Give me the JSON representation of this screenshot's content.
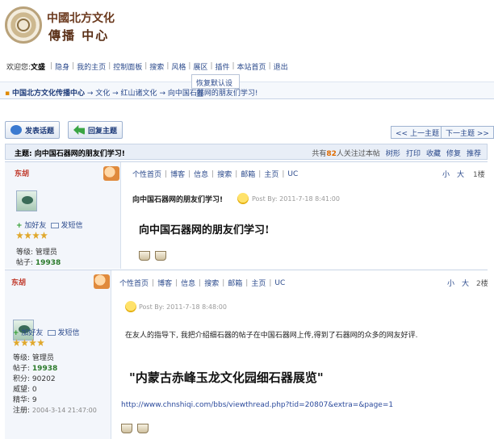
{
  "brand": {
    "line1": "中國北方文化",
    "line2": "傳播  中心"
  },
  "nav": {
    "welcome": "欢迎您:",
    "user": "文盛",
    "items": [
      "隐身",
      "我的主页",
      "控制面板",
      "搜索",
      "风格",
      "展区",
      "插件",
      "本站首页",
      "退出"
    ]
  },
  "dropdown": {
    "item": "恢复默认设置"
  },
  "breadcrumb": {
    "root": "中国北方文化传播中心",
    "parts": [
      "→ 文化",
      "→ 红山诸文化",
      "→ 向中国石器网的朋友们学习!"
    ]
  },
  "buttons": {
    "new_topic": "发表话题",
    "reply": "回复主题",
    "prev": "<< 上一主题",
    "next": "下一主题 >>"
  },
  "topic": {
    "label": "主题: 向中国石器网的朋友们学习!",
    "count_prefix": "共有",
    "count": "82",
    "count_suffix": "人关注过本帖",
    "tools": [
      "树形",
      "打印",
      "收藏",
      "修复",
      "推荐"
    ]
  },
  "post_nav": [
    "个性首页",
    "博客",
    "信息",
    "搜索",
    "邮箱",
    "主页",
    "UC"
  ],
  "size_small": "小",
  "size_big": "大",
  "posts": [
    {
      "author": "东胡",
      "floor": "1楼",
      "add_friend": "加好友",
      "send_msg": "发短信",
      "level_label": "等级: 管理员",
      "posts_label": "帖子:",
      "posts_value": "19938",
      "title": "向中国石器网的朋友们学习!",
      "postby": "Post By: 2011-7-18 8:41:00",
      "body_heading": "向中国石器网的朋友们学习!"
    },
    {
      "author": "东胡",
      "floor": "2楼",
      "add_friend": "加好友",
      "send_msg": "发短信",
      "level_label": "等级: 管理员",
      "posts_label": "帖子:",
      "posts_value": "19938",
      "points_label": "积分:",
      "points_value": "90202",
      "weiwang_label": "威望:",
      "weiwang_value": "0",
      "jinghua_label": "精华:",
      "jinghua_value": "9",
      "reg_label": "注册:",
      "reg_value": "2004-3-14 21:47:00",
      "postby": "Post By: 2011-7-18 8:48:00",
      "body_text": "在友人的指导下, 我把介绍细石器的帖子在中国石器网上传,得到了石器网的众多的网友好评.",
      "body_heading": "\"内蒙古赤峰玉龙文化园细石器展览\"",
      "body_link": "http://www.chnshiqi.com/bbs/viewthread.php?tid=20807&extra=&page=1"
    }
  ]
}
